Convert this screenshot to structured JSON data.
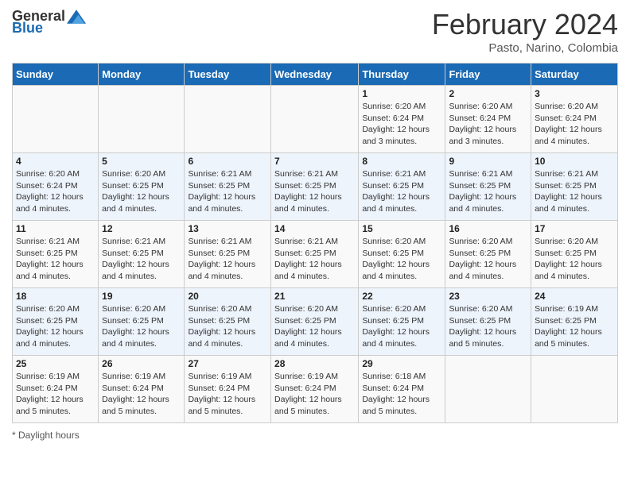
{
  "logo": {
    "general": "General",
    "blue": "Blue"
  },
  "title": "February 2024",
  "subtitle": "Pasto, Narino, Colombia",
  "days_of_week": [
    "Sunday",
    "Monday",
    "Tuesday",
    "Wednesday",
    "Thursday",
    "Friday",
    "Saturday"
  ],
  "weeks": [
    [
      {
        "num": "",
        "info": ""
      },
      {
        "num": "",
        "info": ""
      },
      {
        "num": "",
        "info": ""
      },
      {
        "num": "",
        "info": ""
      },
      {
        "num": "1",
        "info": "Sunrise: 6:20 AM\nSunset: 6:24 PM\nDaylight: 12 hours and 3 minutes."
      },
      {
        "num": "2",
        "info": "Sunrise: 6:20 AM\nSunset: 6:24 PM\nDaylight: 12 hours and 3 minutes."
      },
      {
        "num": "3",
        "info": "Sunrise: 6:20 AM\nSunset: 6:24 PM\nDaylight: 12 hours and 4 minutes."
      }
    ],
    [
      {
        "num": "4",
        "info": "Sunrise: 6:20 AM\nSunset: 6:24 PM\nDaylight: 12 hours and 4 minutes."
      },
      {
        "num": "5",
        "info": "Sunrise: 6:20 AM\nSunset: 6:25 PM\nDaylight: 12 hours and 4 minutes."
      },
      {
        "num": "6",
        "info": "Sunrise: 6:21 AM\nSunset: 6:25 PM\nDaylight: 12 hours and 4 minutes."
      },
      {
        "num": "7",
        "info": "Sunrise: 6:21 AM\nSunset: 6:25 PM\nDaylight: 12 hours and 4 minutes."
      },
      {
        "num": "8",
        "info": "Sunrise: 6:21 AM\nSunset: 6:25 PM\nDaylight: 12 hours and 4 minutes."
      },
      {
        "num": "9",
        "info": "Sunrise: 6:21 AM\nSunset: 6:25 PM\nDaylight: 12 hours and 4 minutes."
      },
      {
        "num": "10",
        "info": "Sunrise: 6:21 AM\nSunset: 6:25 PM\nDaylight: 12 hours and 4 minutes."
      }
    ],
    [
      {
        "num": "11",
        "info": "Sunrise: 6:21 AM\nSunset: 6:25 PM\nDaylight: 12 hours and 4 minutes."
      },
      {
        "num": "12",
        "info": "Sunrise: 6:21 AM\nSunset: 6:25 PM\nDaylight: 12 hours and 4 minutes."
      },
      {
        "num": "13",
        "info": "Sunrise: 6:21 AM\nSunset: 6:25 PM\nDaylight: 12 hours and 4 minutes."
      },
      {
        "num": "14",
        "info": "Sunrise: 6:21 AM\nSunset: 6:25 PM\nDaylight: 12 hours and 4 minutes."
      },
      {
        "num": "15",
        "info": "Sunrise: 6:20 AM\nSunset: 6:25 PM\nDaylight: 12 hours and 4 minutes."
      },
      {
        "num": "16",
        "info": "Sunrise: 6:20 AM\nSunset: 6:25 PM\nDaylight: 12 hours and 4 minutes."
      },
      {
        "num": "17",
        "info": "Sunrise: 6:20 AM\nSunset: 6:25 PM\nDaylight: 12 hours and 4 minutes."
      }
    ],
    [
      {
        "num": "18",
        "info": "Sunrise: 6:20 AM\nSunset: 6:25 PM\nDaylight: 12 hours and 4 minutes."
      },
      {
        "num": "19",
        "info": "Sunrise: 6:20 AM\nSunset: 6:25 PM\nDaylight: 12 hours and 4 minutes."
      },
      {
        "num": "20",
        "info": "Sunrise: 6:20 AM\nSunset: 6:25 PM\nDaylight: 12 hours and 4 minutes."
      },
      {
        "num": "21",
        "info": "Sunrise: 6:20 AM\nSunset: 6:25 PM\nDaylight: 12 hours and 4 minutes."
      },
      {
        "num": "22",
        "info": "Sunrise: 6:20 AM\nSunset: 6:25 PM\nDaylight: 12 hours and 4 minutes."
      },
      {
        "num": "23",
        "info": "Sunrise: 6:20 AM\nSunset: 6:25 PM\nDaylight: 12 hours and 5 minutes."
      },
      {
        "num": "24",
        "info": "Sunrise: 6:19 AM\nSunset: 6:25 PM\nDaylight: 12 hours and 5 minutes."
      }
    ],
    [
      {
        "num": "25",
        "info": "Sunrise: 6:19 AM\nSunset: 6:24 PM\nDaylight: 12 hours and 5 minutes."
      },
      {
        "num": "26",
        "info": "Sunrise: 6:19 AM\nSunset: 6:24 PM\nDaylight: 12 hours and 5 minutes."
      },
      {
        "num": "27",
        "info": "Sunrise: 6:19 AM\nSunset: 6:24 PM\nDaylight: 12 hours and 5 minutes."
      },
      {
        "num": "28",
        "info": "Sunrise: 6:19 AM\nSunset: 6:24 PM\nDaylight: 12 hours and 5 minutes."
      },
      {
        "num": "29",
        "info": "Sunrise: 6:18 AM\nSunset: 6:24 PM\nDaylight: 12 hours and 5 minutes."
      },
      {
        "num": "",
        "info": ""
      },
      {
        "num": "",
        "info": ""
      }
    ]
  ],
  "footer": "Daylight hours"
}
